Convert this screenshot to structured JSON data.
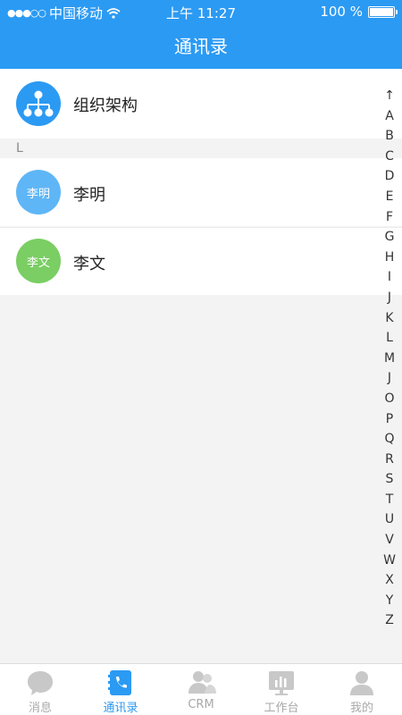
{
  "status_bar": {
    "carrier": "中国移动",
    "time": "上午 11:27",
    "battery": "100 %"
  },
  "header": {
    "title": "通讯录"
  },
  "org_item": {
    "label": "组织架构"
  },
  "section_letter": "L",
  "contacts": [
    {
      "name": "李明",
      "avatar_text": "李明",
      "avatar_color": "#5fb6f6"
    },
    {
      "name": "李文",
      "avatar_text": "李文",
      "avatar_color": "#7ace63"
    }
  ],
  "index_bar": [
    "↑",
    "A",
    "B",
    "C",
    "D",
    "E",
    "F",
    "G",
    "H",
    "I",
    "J",
    "K",
    "L",
    "M",
    "J",
    "O",
    "P",
    "Q",
    "R",
    "S",
    "T",
    "U",
    "V",
    "W",
    "X",
    "Y",
    "Z"
  ],
  "tabs": [
    {
      "label": "消息",
      "icon": "message-icon",
      "active": false
    },
    {
      "label": "通讯录",
      "icon": "contacts-icon",
      "active": true
    },
    {
      "label": "CRM",
      "icon": "crm-icon",
      "active": false
    },
    {
      "label": "工作台",
      "icon": "workbench-icon",
      "active": false
    },
    {
      "label": "我的",
      "icon": "profile-icon",
      "active": false
    }
  ],
  "colors": {
    "primary": "#2b9af3",
    "inactive": "#a8a8a8",
    "background": "#f3f3f3"
  }
}
